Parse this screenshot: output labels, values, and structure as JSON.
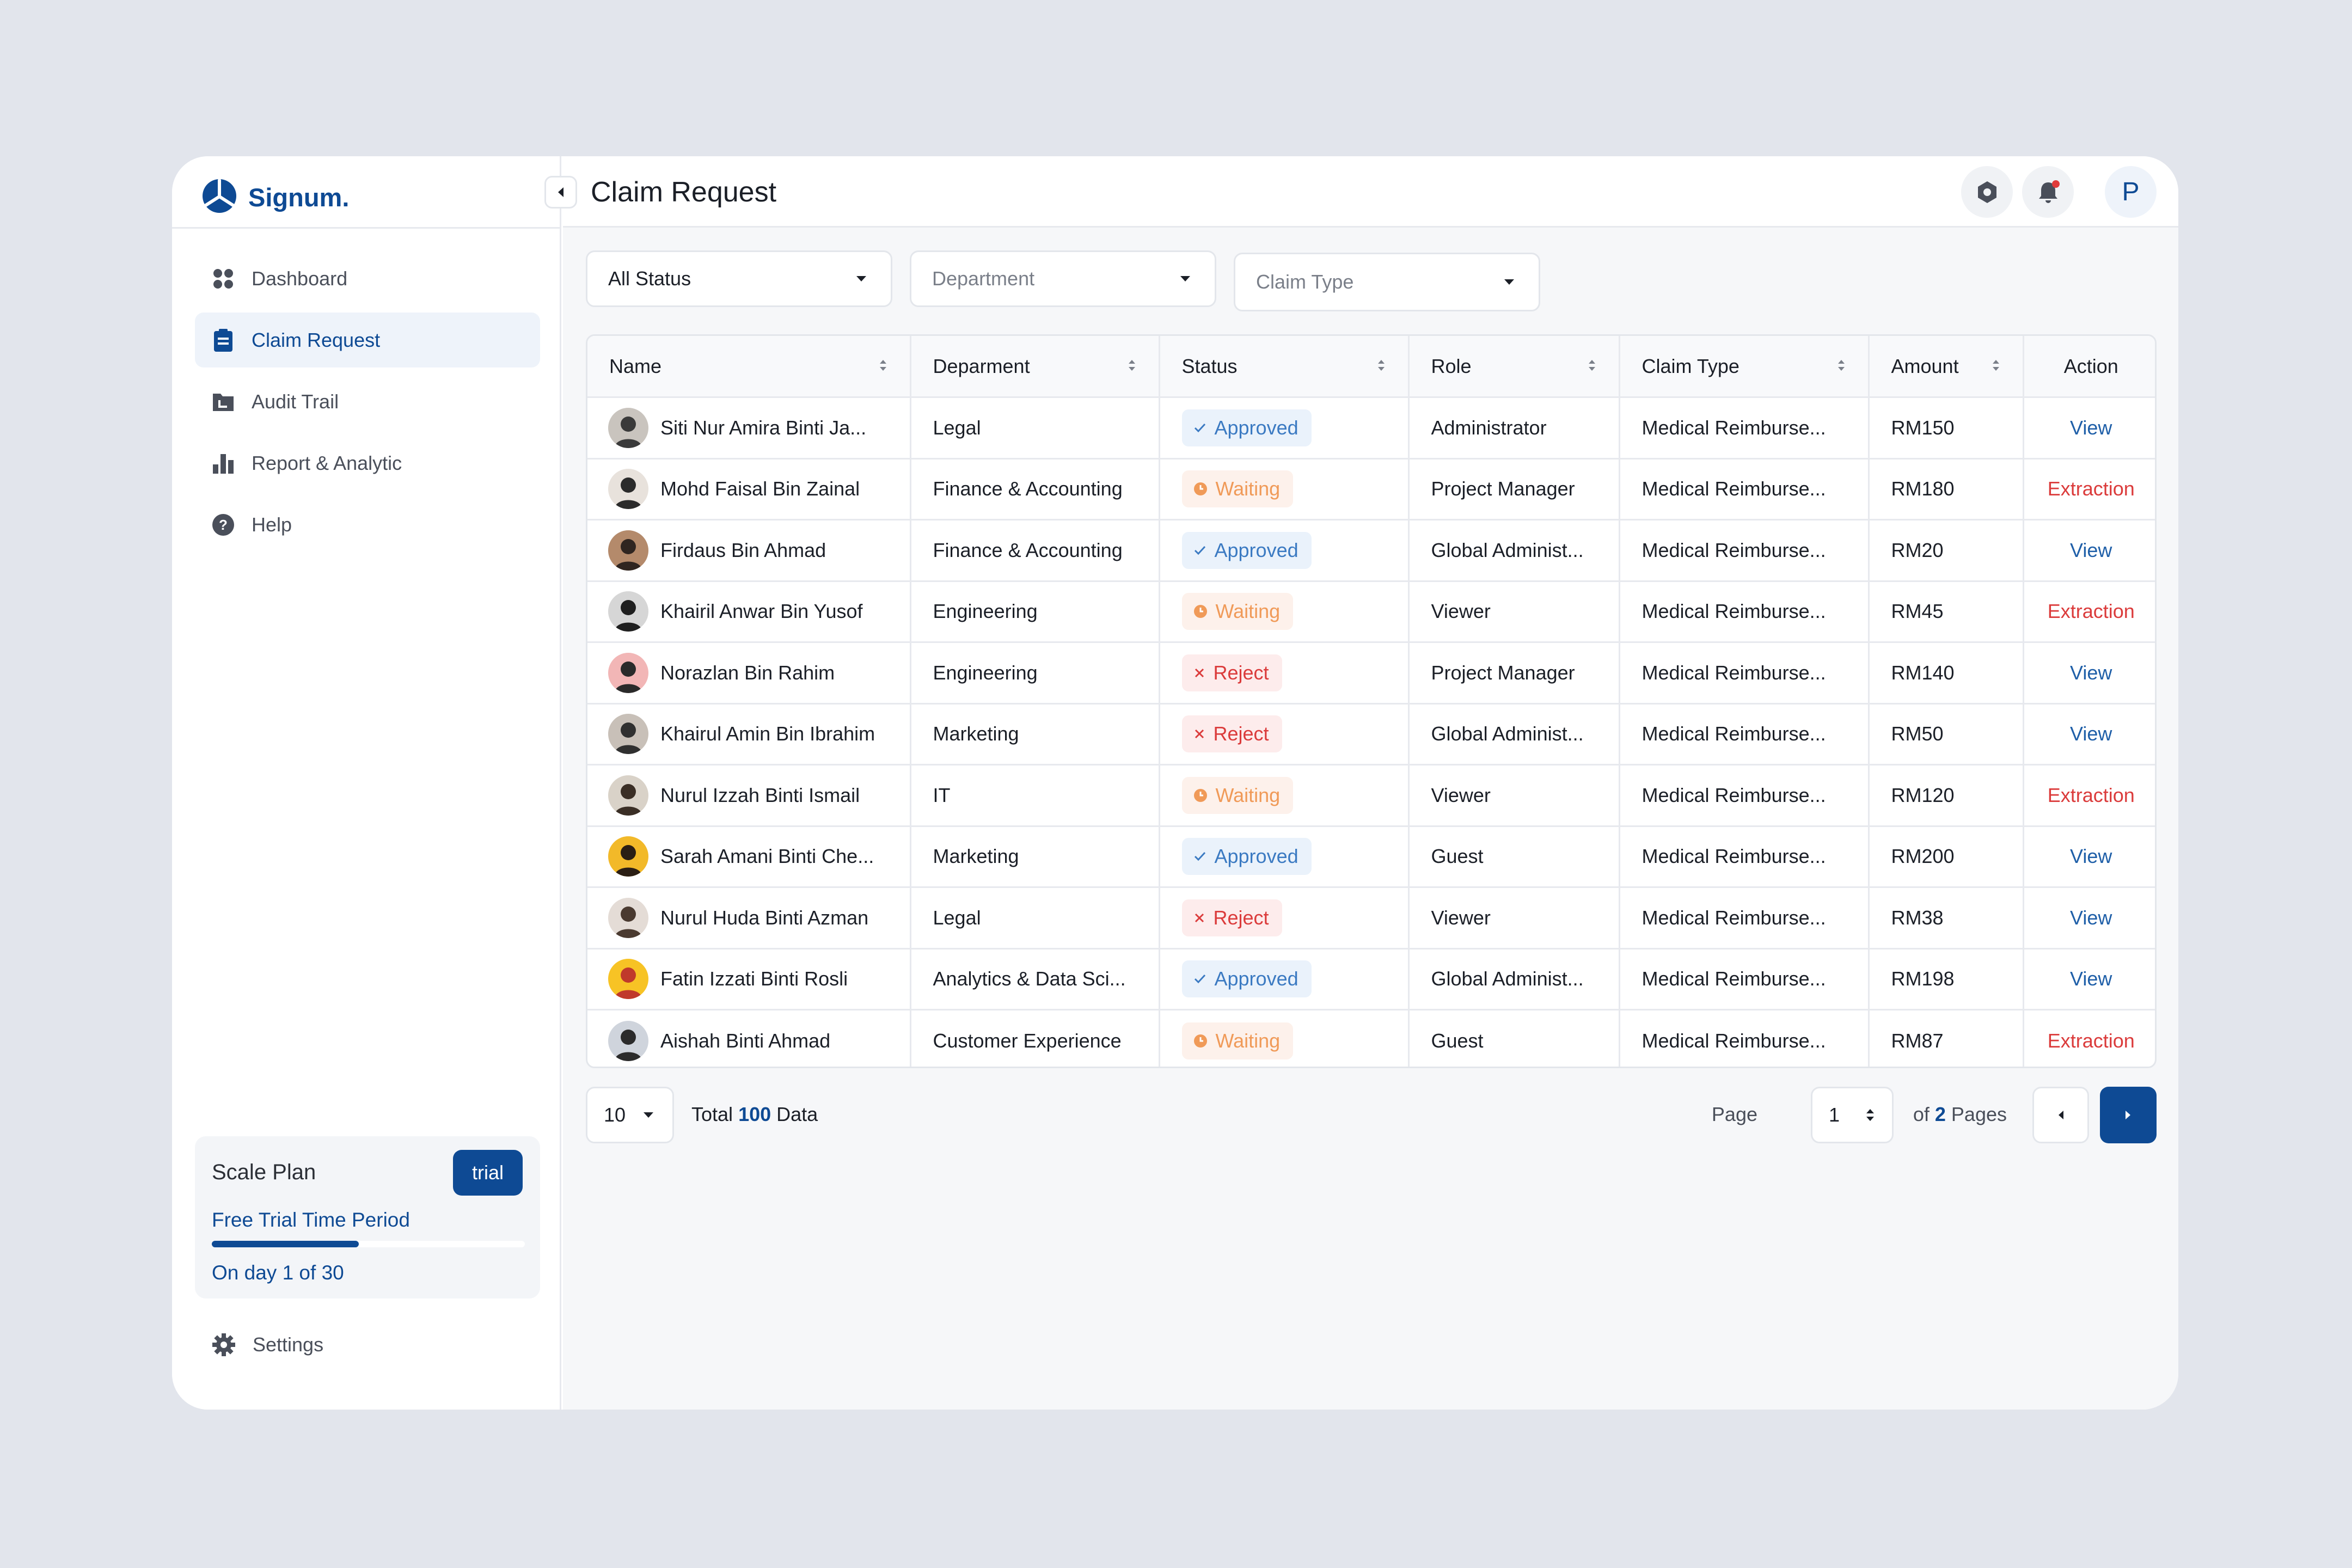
{
  "app": {
    "name": "Signum."
  },
  "sidebar": {
    "items": [
      {
        "label": "Dashboard",
        "icon": "grid-icon",
        "active": false
      },
      {
        "label": "Claim Request",
        "icon": "clipboard-icon",
        "active": true
      },
      {
        "label": "Audit Trail",
        "icon": "folder-icon",
        "active": false
      },
      {
        "label": "Report & Analytic",
        "icon": "bar-chart-icon",
        "active": false
      },
      {
        "label": "Help",
        "icon": "help-circle-icon",
        "active": false
      }
    ],
    "plan": {
      "title": "Scale Plan",
      "badge": "trial",
      "subtitle": "Free Trial Time Period",
      "progress": 0.47,
      "day_text": "On day 1 of 30"
    },
    "settings_label": "Settings"
  },
  "header": {
    "title": "Claim Request",
    "avatar_initial": "P",
    "notification_dot_color": "#e03b3b"
  },
  "filters": {
    "status": "All Status",
    "department": "Department",
    "claim_type": "Claim Type"
  },
  "table": {
    "columns": [
      "Name",
      "Deparment",
      "Status",
      "Role",
      "Claim Type",
      "Amount",
      "Action"
    ],
    "rows": [
      {
        "name": "Siti Nur Amira Binti Ja...",
        "department": "Legal",
        "status": "Approved",
        "role": "Administrator",
        "claim_type": "Medical Reimburse...",
        "amount": "RM150",
        "action": "View"
      },
      {
        "name": "Mohd Faisal Bin Zainal",
        "department": "Finance & Accounting",
        "status": "Waiting",
        "role": "Project Manager",
        "claim_type": "Medical Reimburse...",
        "amount": "RM180",
        "action": "Extraction"
      },
      {
        "name": "Firdaus Bin Ahmad",
        "department": "Finance & Accounting",
        "status": "Approved",
        "role": "Global Administ...",
        "claim_type": "Medical Reimburse...",
        "amount": "RM20",
        "action": "View"
      },
      {
        "name": "Khairil Anwar Bin Yusof",
        "department": "Engineering",
        "status": "Waiting",
        "role": "Viewer",
        "claim_type": "Medical Reimburse...",
        "amount": "RM45",
        "action": "Extraction"
      },
      {
        "name": "Norazlan Bin Rahim",
        "department": "Engineering",
        "status": "Reject",
        "role": "Project Manager",
        "claim_type": "Medical Reimburse...",
        "amount": "RM140",
        "action": "View"
      },
      {
        "name": "Khairul Amin Bin Ibrahim",
        "department": "Marketing",
        "status": "Reject",
        "role": "Global Administ...",
        "claim_type": "Medical Reimburse...",
        "amount": "RM50",
        "action": "View"
      },
      {
        "name": "Nurul Izzah Binti Ismail",
        "department": "IT",
        "status": "Waiting",
        "role": "Viewer",
        "claim_type": "Medical Reimburse...",
        "amount": "RM120",
        "action": "Extraction"
      },
      {
        "name": "Sarah Amani Binti Che...",
        "department": "Marketing",
        "status": "Approved",
        "role": "Guest",
        "claim_type": "Medical Reimburse...",
        "amount": "RM200",
        "action": "View"
      },
      {
        "name": "Nurul Huda Binti Azman",
        "department": "Legal",
        "status": "Reject",
        "role": "Viewer",
        "claim_type": "Medical Reimburse...",
        "amount": "RM38",
        "action": "View"
      },
      {
        "name": "Fatin Izzati Binti Rosli",
        "department": "Analytics & Data Sci...",
        "status": "Approved",
        "role": "Global Administ...",
        "claim_type": "Medical Reimburse...",
        "amount": "RM198",
        "action": "View"
      },
      {
        "name": "Aishah Binti Ahmad",
        "department": "Customer Experience",
        "status": "Waiting",
        "role": "Guest",
        "claim_type": "Medical Reimburse...",
        "amount": "RM87",
        "action": "Extraction"
      }
    ]
  },
  "pagination": {
    "page_size": "10",
    "total_prefix": "Total",
    "total_count": "100",
    "total_suffix": "Data",
    "page_label": "Page",
    "current_page": "1",
    "of_prefix": "of",
    "total_pages": "2",
    "pages_suffix": "Pages"
  },
  "colors": {
    "brand": "#0e4a94",
    "approved": "#3b7ac2",
    "waiting": "#f09a58",
    "reject": "#db3b3b"
  }
}
